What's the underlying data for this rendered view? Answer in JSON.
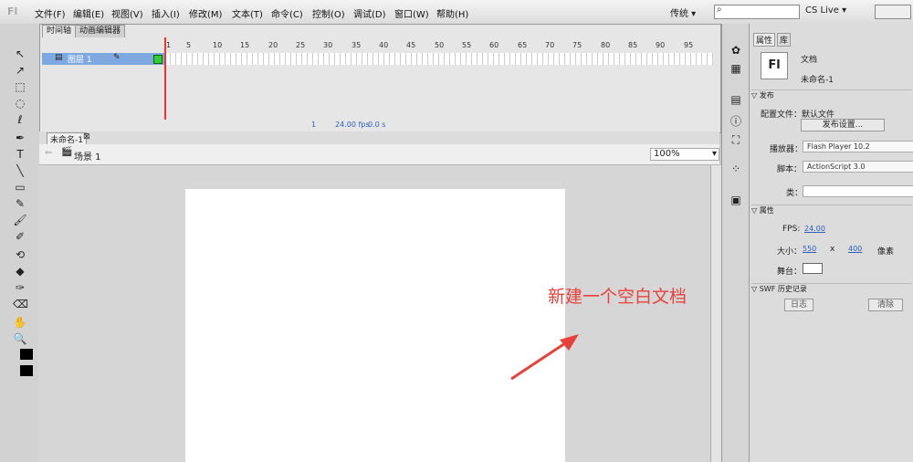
{
  "app": {
    "logo": "Fl"
  },
  "menu": [
    "文件(F)",
    "编辑(E)",
    "视图(V)",
    "插入(I)",
    "修改(M)",
    "文本(T)",
    "命令(C)",
    "控制(O)",
    "调试(D)",
    "窗口(W)",
    "帮助(H)"
  ],
  "topright": {
    "workspace": "传统 ▾",
    "search_placeholder": "",
    "cslive": "CS Live ▾"
  },
  "timeline": {
    "tabs": [
      "时间轴",
      "动画编辑器"
    ],
    "ruler": [
      "1",
      "5",
      "10",
      "15",
      "20",
      "25",
      "30",
      "35",
      "40",
      "45",
      "50",
      "55",
      "60",
      "65",
      "70",
      "75",
      "80",
      "85",
      "90",
      "95"
    ],
    "layer_name": "图层 1",
    "status": {
      "frame": "1",
      "fps": "24.00 fps",
      "time": "0.0 s"
    }
  },
  "document": {
    "tab": "未命名-1",
    "scene": "场景 1",
    "zoom": "100%"
  },
  "annotation": "新建一个空白文档",
  "properties": {
    "tabs": [
      "属性",
      "库"
    ],
    "doc_type": "文档",
    "doc_name": "未命名-1",
    "section_publish": "发布",
    "profile_label": "配置文件：默认文件",
    "publish_settings": "发布设置...",
    "player_label": "播放器：",
    "player_value": "Flash Player 10.2",
    "script_label": "脚本：",
    "script_value": "ActionScript 3.0",
    "class_label": "类：",
    "section_props": "属性",
    "fps_label": "FPS:",
    "fps_value": "24.00",
    "size_label": "大小：",
    "width": "550",
    "x": "x",
    "height": "400",
    "unit": "像素",
    "stage_label": "舞台：",
    "section_swf": "SWF 历史记录",
    "log_btn": "日志",
    "clear_btn": "清除"
  },
  "tools": [
    "↖",
    "↗",
    "⬚",
    "◌",
    "ℓ",
    "✒",
    "T",
    "╲",
    "▭",
    "✎",
    "🖌",
    "✐",
    "⟲",
    "◆",
    "✑",
    "⌫",
    "✋",
    "🔍"
  ]
}
